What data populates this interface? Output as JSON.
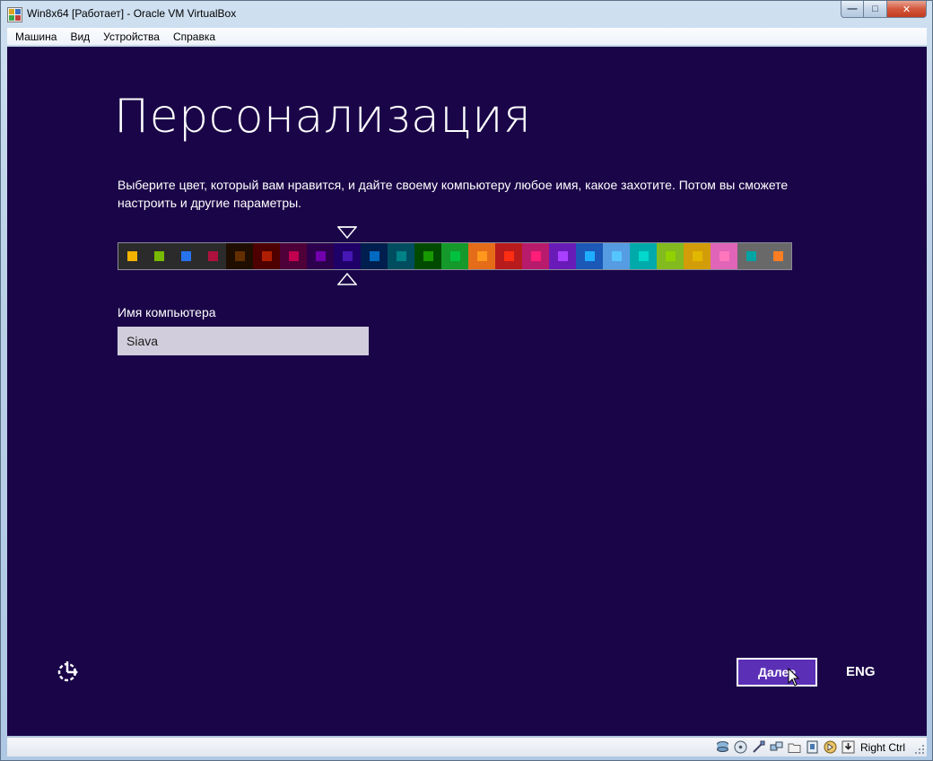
{
  "window": {
    "title": "Win8x64 [Работает] - Oracle VM VirtualBox",
    "minimize_glyph": "—",
    "maximize_glyph": "□",
    "close_glyph": "✕"
  },
  "menu": [
    "Машина",
    "Вид",
    "Устройства",
    "Справка"
  ],
  "setup": {
    "title": "Персонализация",
    "description": "Выберите цвет, который вам нравится, и дайте своему компьютеру любое имя, какое захотите. Потом вы сможете настроить и другие параметры.",
    "palette": {
      "selected_index": 8,
      "swatches": [
        {
          "bg": "#2b2b2b",
          "chip": "#f4b300"
        },
        {
          "bg": "#2b2b2b",
          "chip": "#78ba00"
        },
        {
          "bg": "#2b2b2b",
          "chip": "#2673ec"
        },
        {
          "bg": "#2b2b2b",
          "chip": "#ae113d"
        },
        {
          "bg": "#1f0e00",
          "chip": "#632f00"
        },
        {
          "bg": "#4e0000",
          "chip": "#b01e00"
        },
        {
          "bg": "#4e0038",
          "chip": "#c1004f"
        },
        {
          "bg": "#2d004e",
          "chip": "#7200ac"
        },
        {
          "bg": "#1f0068",
          "chip": "#4617b4"
        },
        {
          "bg": "#001e4e",
          "chip": "#006ac1"
        },
        {
          "bg": "#004d60",
          "chip": "#008287"
        },
        {
          "bg": "#004a00",
          "chip": "#199900"
        },
        {
          "bg": "#15992a",
          "chip": "#00c13f"
        },
        {
          "bg": "#e56c19",
          "chip": "#ff981d"
        },
        {
          "bg": "#b81b1b",
          "chip": "#ff2e12"
        },
        {
          "bg": "#b81b6c",
          "chip": "#ff1d77"
        },
        {
          "bg": "#691bb8",
          "chip": "#aa40ff"
        },
        {
          "bg": "#1b58b8",
          "chip": "#1faeff"
        },
        {
          "bg": "#569ce3",
          "chip": "#56c5ff"
        },
        {
          "bg": "#00aaaa",
          "chip": "#00d8cc"
        },
        {
          "bg": "#83ba1f",
          "chip": "#91d100"
        },
        {
          "bg": "#d39d09",
          "chip": "#e1b700"
        },
        {
          "bg": "#e064b7",
          "chip": "#ff76bc"
        },
        {
          "bg": "#696969",
          "chip": "#00a4a4"
        },
        {
          "bg": "#696969",
          "chip": "#ff7d23"
        }
      ]
    },
    "name_label": "Имя компьютера",
    "name_value": "Siava",
    "next_label": "Далее",
    "language": "ENG"
  },
  "statusbar": {
    "host_key": "Right Ctrl"
  }
}
